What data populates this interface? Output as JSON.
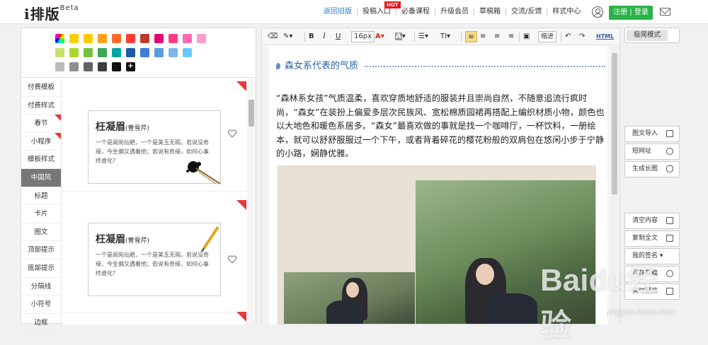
{
  "brand": {
    "logo": "i排版",
    "beta": "Beta"
  },
  "nav": {
    "items": [
      "返回旧版",
      "投稿入口",
      "必备课程",
      "升级会员",
      "草稿箱",
      "交流/反馈",
      "样式中心"
    ],
    "hot_badge": "HOT"
  },
  "auth": {
    "login_label": "注册 | 登录"
  },
  "palette": {
    "colors": [
      "#f5d200",
      "#ffcc00",
      "#ff9f1a",
      "#ff6a2a",
      "#ff3b30",
      "#c0392b",
      "#e4006f",
      "#ff3d7f",
      "#ff69b4",
      "#ff9ccf",
      "#c7e06a",
      "#a9d82f",
      "#73c23b",
      "#3aa857",
      "#00a6a6",
      "#1e5aa8",
      "#3d7ed6",
      "#5b9be0",
      "#7db7ea",
      "#66ccff",
      "#bdbdbd",
      "#8f8f8f",
      "#616161",
      "#3d3d3d",
      "#111111"
    ],
    "plus_label": "+"
  },
  "categories": [
    "付费模板",
    "付费样式",
    "春节",
    "小程序",
    "模板样式",
    "中国风",
    "标题",
    "卡片",
    "图文",
    "顶部提示",
    "底部提示",
    "分隔线",
    "小符号",
    "边框"
  ],
  "templates": [
    {
      "name": "枉凝眉",
      "author": "(曹雪芹)",
      "verse": "一个是阆苑仙葩，一个是美玉无瑕。若说没奇缘，今生偏又遇着他；若说有奇缘，如何心事终虚化？"
    },
    {
      "name": "枉凝眉",
      "author": "(曹雪芹)",
      "verse": "一个是阆苑仙葩，一个是美玉无瑕。若说没奇缘，今生偏又遇着他；若说有奇缘，如何心事终虚化？"
    }
  ],
  "toolbar": {
    "font_size": "16px",
    "indent_label": "缩进",
    "html_label": "HTML"
  },
  "article": {
    "heading": "森女系代表的气质",
    "paragraph": "“森林系女孩”气质温柔，喜欢穿质地舒适的服装并且崇尚自然，不随意追流行疯时尚，“森女”在装扮上偏爱多层次民族风、宽松棉质园裙再搭配上编织材质小物，颜色也以大地色和暖色系居多。“森女”最喜欢做的事就是找一个咖啡厅，一杯饮料，一册绘本，就可以舒舒服服过一个下午，或者背着碎花的樱花粉般的双肩包在悠闲小步于宁静的小路，娴静优雅。"
  },
  "right_panel": {
    "mode_label": "极简模式",
    "buttons_top": [
      "图文导入",
      "短网址",
      "生成长图"
    ],
    "buttons_bottom": [
      "清空内容",
      "复制全文",
      "我的签名 ▾",
      "保存草稿",
      "实时预览"
    ]
  },
  "watermark": {
    "main": "Baidu经验",
    "sub": "jingyan.baidu.com"
  }
}
